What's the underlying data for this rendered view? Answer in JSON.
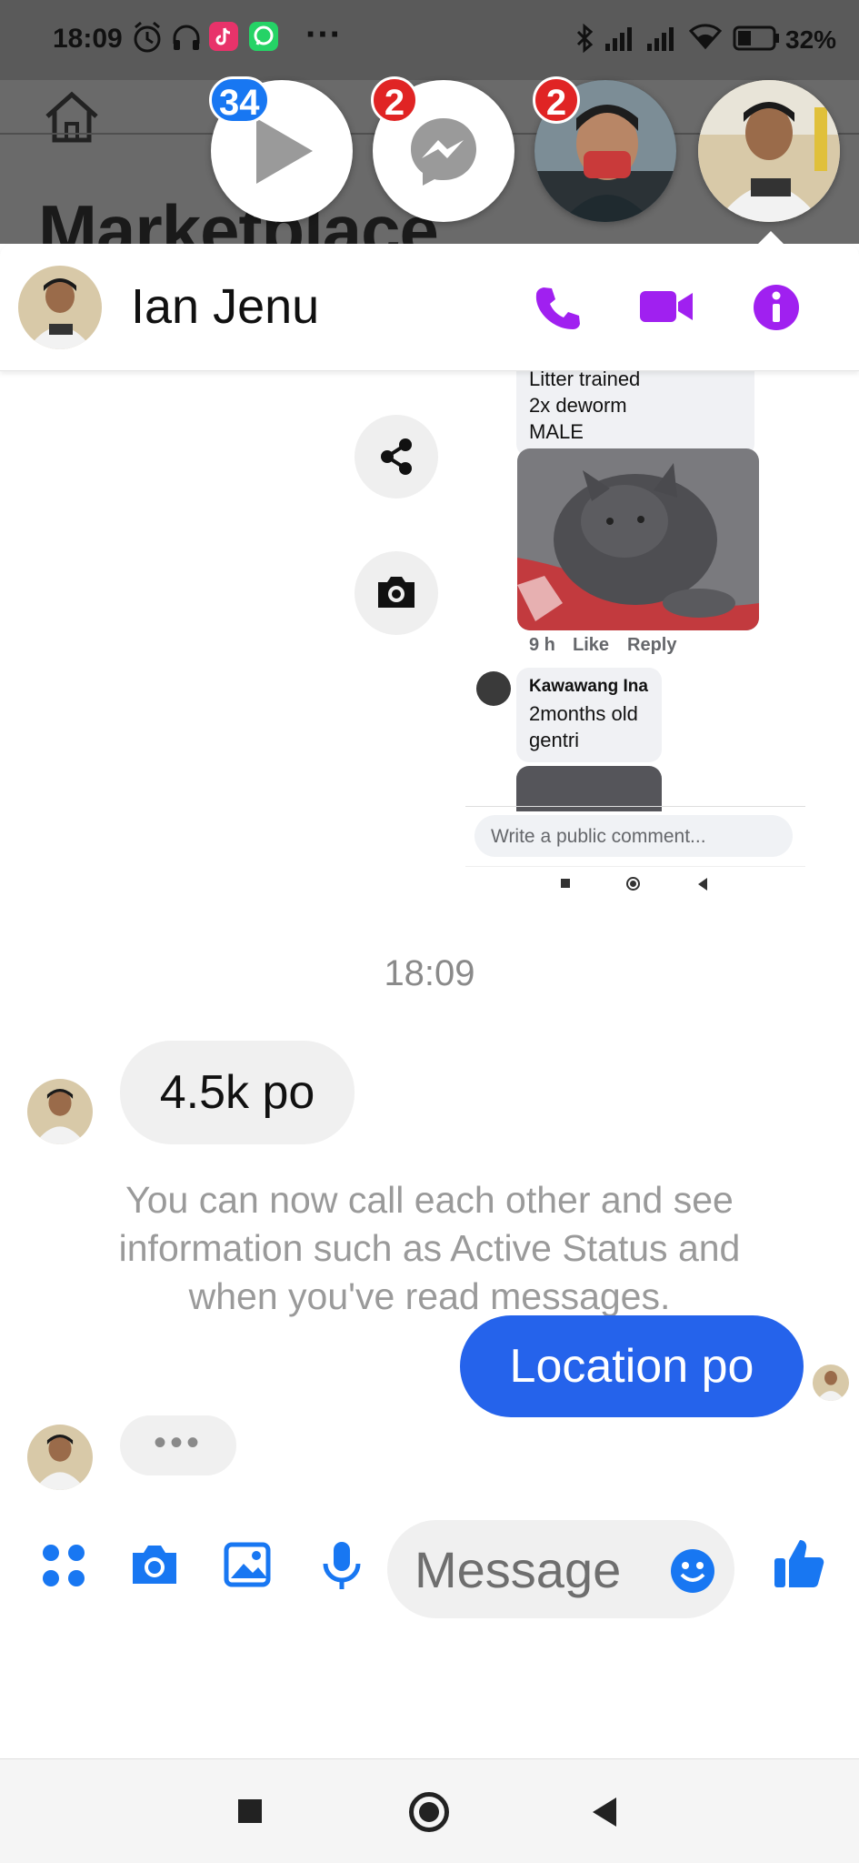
{
  "status_bar": {
    "time": "18:09",
    "dots": "···",
    "battery": "32%"
  },
  "background_app": {
    "title": "Marketplace"
  },
  "chat_heads": [
    {
      "name": "video-chathead",
      "badge": "34",
      "badge_color": "#1877f2"
    },
    {
      "name": "messenger-chathead",
      "badge": "2",
      "badge_color": "#e02424"
    },
    {
      "name": "contact-chathead",
      "badge": "2",
      "badge_color": "#e02424"
    },
    {
      "name": "active-chathead",
      "badge": "",
      "badge_color": ""
    }
  ],
  "chat_header": {
    "contact_name": "Ian Jenu",
    "accent_color": "#a020f0"
  },
  "shared_screenshot": {
    "post_lines": [
      "Litter trained",
      "2x deworm",
      "MALE"
    ],
    "meta": {
      "time": "9 h",
      "like": "Like",
      "reply": "Reply"
    },
    "comment_author": "Kawawang Ina",
    "comment_lines": [
      "2months old",
      "gentri"
    ],
    "comment_placeholder": "Write a public comment..."
  },
  "messages": {
    "timestamp": "18:09",
    "incoming_1": "4.5k po",
    "system_note": "You can now call each other and see information such as Active Status and when you've read messages.",
    "outgoing_1": "Location po",
    "typing": "•••"
  },
  "composer": {
    "placeholder": "Message",
    "accent_color": "#1877f2"
  }
}
